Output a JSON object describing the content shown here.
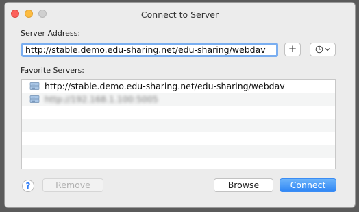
{
  "window": {
    "title": "Connect to Server"
  },
  "server_address": {
    "label": "Server Address:",
    "value": "http://stable.demo.edu-sharing.net/edu-sharing/webdav"
  },
  "add_button": {
    "label": "+"
  },
  "recent_servers": {
    "icon": "clock-icon",
    "chevron": "chevron-down-icon"
  },
  "favorites": {
    "label": "Favorite Servers:",
    "items": [
      {
        "label": "http://stable.demo.edu-sharing.net/edu-sharing/webdav",
        "icon": "network-drive-icon"
      },
      {
        "label": "http://192.168.1.100:5005",
        "icon": "network-drive-icon",
        "obscured": true
      }
    ]
  },
  "footer": {
    "help_label": "?",
    "remove_label": "Remove",
    "browse_label": "Browse",
    "connect_label": "Connect"
  },
  "colors": {
    "accent": "#2f86f5",
    "focus_ring": "#7aaef0",
    "close": "#fc605b",
    "minimize": "#fdbc40",
    "zoom_disabled": "#d0d0d0"
  }
}
